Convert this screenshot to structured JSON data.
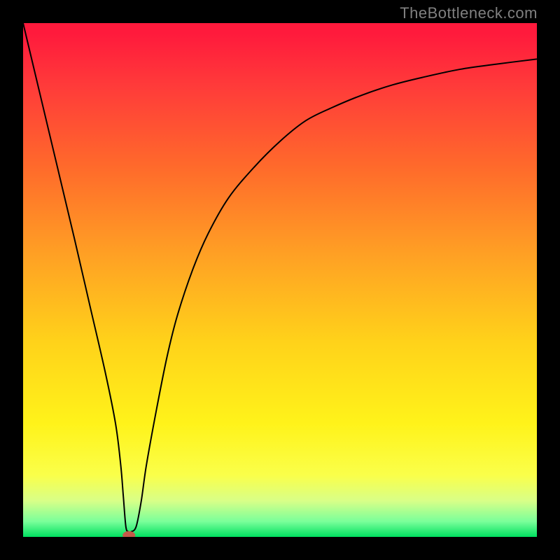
{
  "watermark": "TheBottleneck.com",
  "chart_data": {
    "type": "line",
    "title": "",
    "xlabel": "",
    "ylabel": "",
    "xlim": [
      0,
      100
    ],
    "ylim": [
      0,
      100
    ],
    "grid": false,
    "legend": false,
    "x": [
      0,
      5,
      10,
      13,
      16,
      18,
      19,
      19.5,
      20,
      20.5,
      21,
      22,
      23,
      24,
      26,
      28,
      30,
      33,
      36,
      40,
      45,
      50,
      55,
      60,
      66,
      72,
      78,
      85,
      92,
      100
    ],
    "values": [
      100,
      79,
      58,
      45,
      32,
      22,
      14,
      8,
      2,
      1,
      1,
      2,
      7,
      14,
      25,
      35,
      43,
      52,
      59,
      66,
      72,
      77,
      81,
      83.5,
      86,
      88,
      89.5,
      91,
      92,
      93
    ],
    "min_marker": {
      "x": 20.6,
      "y": 0.3
    }
  }
}
